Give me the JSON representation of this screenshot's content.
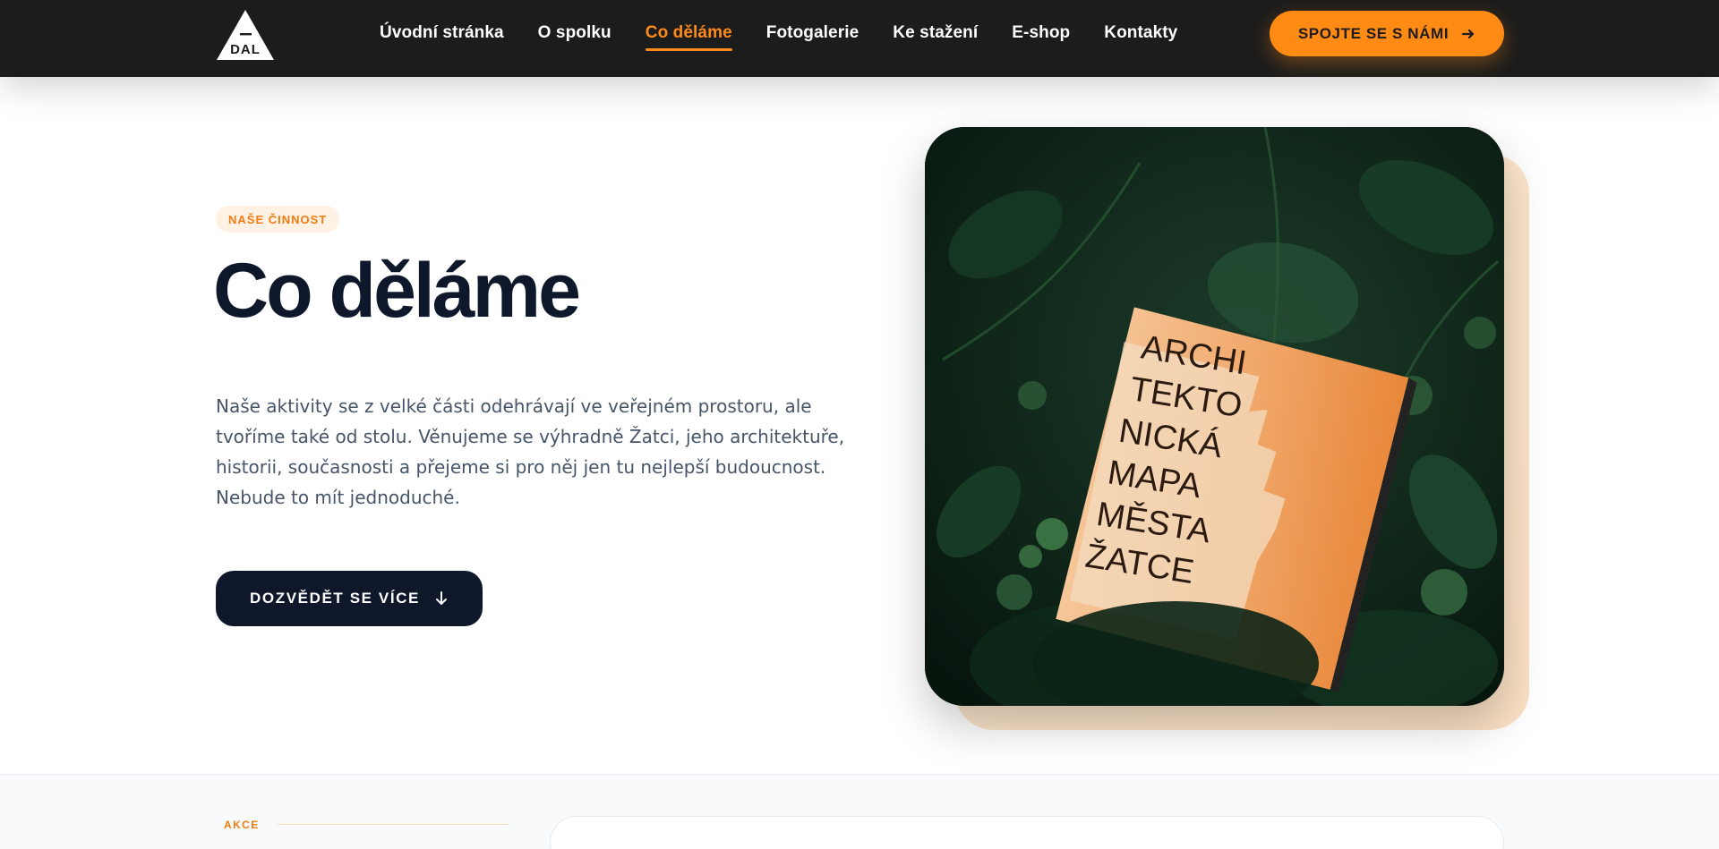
{
  "header": {
    "logo_text": "DAL",
    "nav": [
      {
        "label": "Úvodní stránka",
        "active": false
      },
      {
        "label": "O spolku",
        "active": false
      },
      {
        "label": "Co děláme",
        "active": true
      },
      {
        "label": "Fotogalerie",
        "active": false
      },
      {
        "label": "Ke stažení",
        "active": false
      },
      {
        "label": "E-shop",
        "active": false
      },
      {
        "label": "Kontakty",
        "active": false
      }
    ],
    "cta_label": "SPOJTE SE S NÁMI",
    "cta_icon": "arrow-right-icon"
  },
  "hero": {
    "badge": "NAŠE ČINNOST",
    "title": "Co děláme",
    "description": "Naše aktivity se z velké části odehrávají ve veřejném prostoru, ale tvoříme také od stolu. Věnujeme se výhradně Žatci, jeho architektuře, historii, současnosti a přejeme si pro něj jen tu nejlepší budoucnost. Nebude to mít jednoduché.",
    "button_label": "DOZVĚDĚT SE VÍCE",
    "button_icon": "arrow-down-icon",
    "image": {
      "book_lines": [
        "ARCHI",
        "TEKTO",
        "NICKÁ",
        "MAPA",
        "MĚSTA",
        "ŽATCE"
      ]
    }
  },
  "section2": {
    "label": "AKCE"
  },
  "colors": {
    "accent": "#ff8a14",
    "dark": "#0f172a",
    "header_bg": "#1c1c1c",
    "text_muted": "#475569",
    "badge_bg": "#fff1e4"
  }
}
